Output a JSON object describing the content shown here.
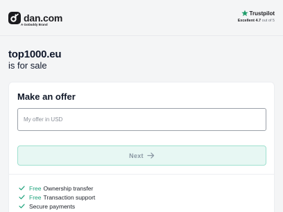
{
  "header": {
    "brand_name": "dan.com",
    "brand_sub": "A GoDaddy Brand",
    "trustpilot": {
      "name": "Trustpilot",
      "rating_label": "Excellent",
      "rating_value": "4.7",
      "rating_suffix": "out of 5"
    }
  },
  "listing": {
    "domain": "top1000.eu",
    "subtitle": "is for sale"
  },
  "offer": {
    "title": "Make an offer",
    "input_placeholder": "My offer in USD",
    "input_value": "",
    "next_label": "Next",
    "benefits": [
      {
        "tag": "Free",
        "text": "Ownership transfer"
      },
      {
        "tag": "Free",
        "text": "Transaction support"
      },
      {
        "tag": "",
        "text": "Secure payments"
      }
    ]
  },
  "colors": {
    "accent_green": "#1fa37c",
    "button_bg": "#e7f7f3",
    "trustpilot_star": "#1f9d6b",
    "text_dark": "#101828"
  },
  "icons": {
    "logo": "dan-logo-icon",
    "trustpilot": "star-icon",
    "next": "arrow-right-icon",
    "benefit": "check-icon"
  }
}
